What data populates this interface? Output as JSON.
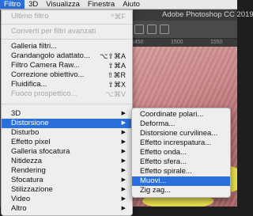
{
  "menubar": {
    "items": [
      "Filtro",
      "3D",
      "Visualizza",
      "Finestra",
      "Aiuto"
    ],
    "active_index": 0
  },
  "app": {
    "title": "Adobe Photoshop CC 2019"
  },
  "ruler": {
    "labels": [
      "1450",
      "1500",
      "1550"
    ]
  },
  "filter_menu": {
    "last_filter": {
      "label": "Ultimo filtro",
      "shortcut": "^⌘F"
    },
    "smart_filters": {
      "label": "Converti per filtri avanzati"
    },
    "gallery": {
      "label": "Galleria filtri..."
    },
    "wide_angle": {
      "label": "Grandangolo adattato...",
      "shortcut": "⌥⇧⌘A"
    },
    "camera_raw": {
      "label": "Filtro Camera Raw...",
      "shortcut": "⇧⌘A"
    },
    "lens": {
      "label": "Correzione obiettivo...",
      "shortcut": "⇧⌘R"
    },
    "liquify": {
      "label": "Fluidifica...",
      "shortcut": "⇧⌘X"
    },
    "vanishing": {
      "label": "Fuoco prospettico...",
      "shortcut": "⌥⌘V"
    },
    "submenus": [
      "3D",
      "Distorsione",
      "Disturbo",
      "Effetto pixel",
      "Galleria sfocatura",
      "Nitidezza",
      "Rendering",
      "Sfocatura",
      "Stilizzazione",
      "Video",
      "Altro"
    ],
    "highlighted": "Distorsione"
  },
  "distort_menu": {
    "items": [
      "Coordinate polari...",
      "Deforma...",
      "Distorsione curvilinea...",
      "Effetto increspatura...",
      "Effetto onda...",
      "Effetto sfera...",
      "Effetto spirale...",
      "Muovi...",
      "Zig zag..."
    ],
    "highlighted": "Muovi..."
  },
  "colors": {
    "highlight": "#2a6fdb",
    "menu_bg": "#eeeeee"
  }
}
